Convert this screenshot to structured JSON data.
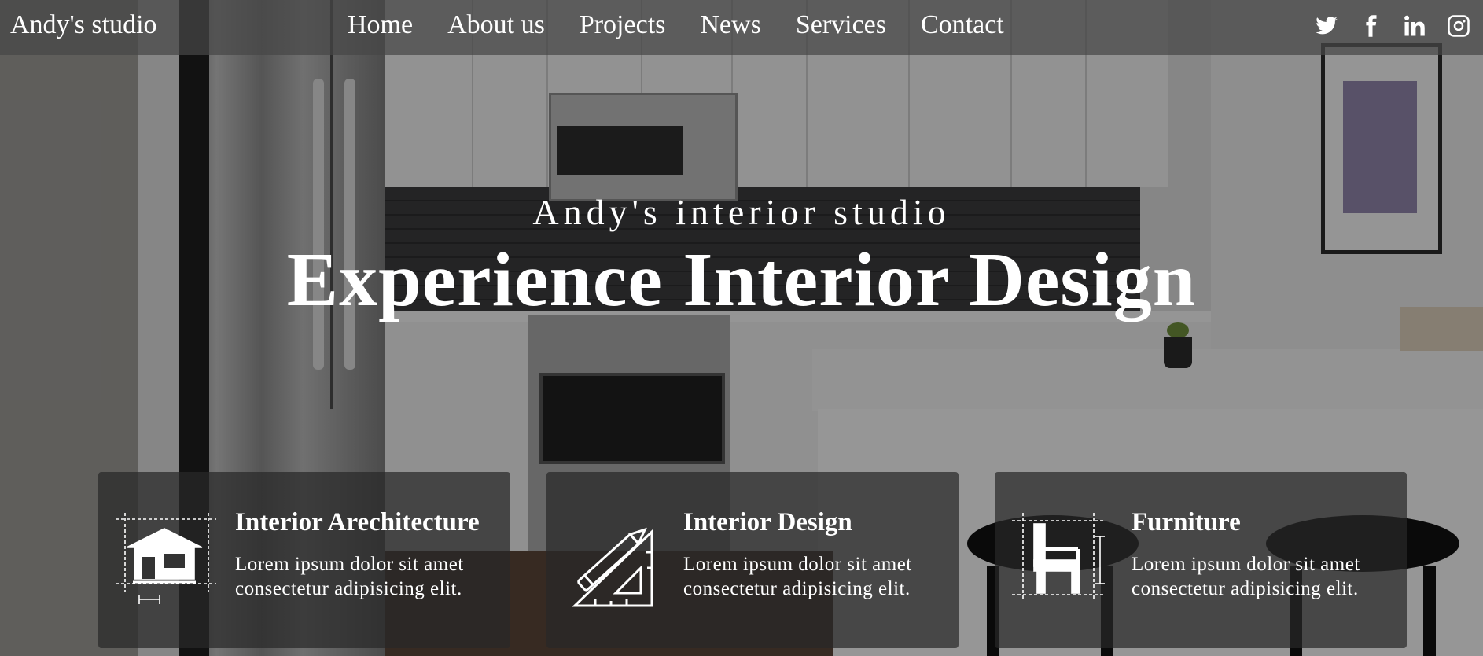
{
  "brand": "Andy's studio",
  "nav": [
    {
      "label": "Home"
    },
    {
      "label": "About us"
    },
    {
      "label": "Projects"
    },
    {
      "label": "News"
    },
    {
      "label": "Services"
    },
    {
      "label": "Contact"
    }
  ],
  "socials": [
    "twitter-icon",
    "facebook-icon",
    "linkedin-icon",
    "instagram-icon"
  ],
  "hero": {
    "subtitle": "Andy's interior studio",
    "title": "Experience Interior Design"
  },
  "cards": [
    {
      "title": "Interior Arechitecture",
      "line1": "Lorem ipsum dolor sit amet",
      "line2": "consectetur adipisicing elit.",
      "icon": "house-blueprint-icon"
    },
    {
      "title": "Interior Design",
      "line1": "Lorem ipsum dolor sit amet",
      "line2": "consectetur adipisicing elit.",
      "icon": "pencil-triangle-icon"
    },
    {
      "title": "Furniture",
      "line1": "Lorem ipsum dolor sit amet",
      "line2": "consectetur adipisicing elit.",
      "icon": "chair-blueprint-icon"
    }
  ],
  "colors": {
    "navbar_bg": "#464646",
    "card_bg": "#282828",
    "text": "#ffffff"
  }
}
